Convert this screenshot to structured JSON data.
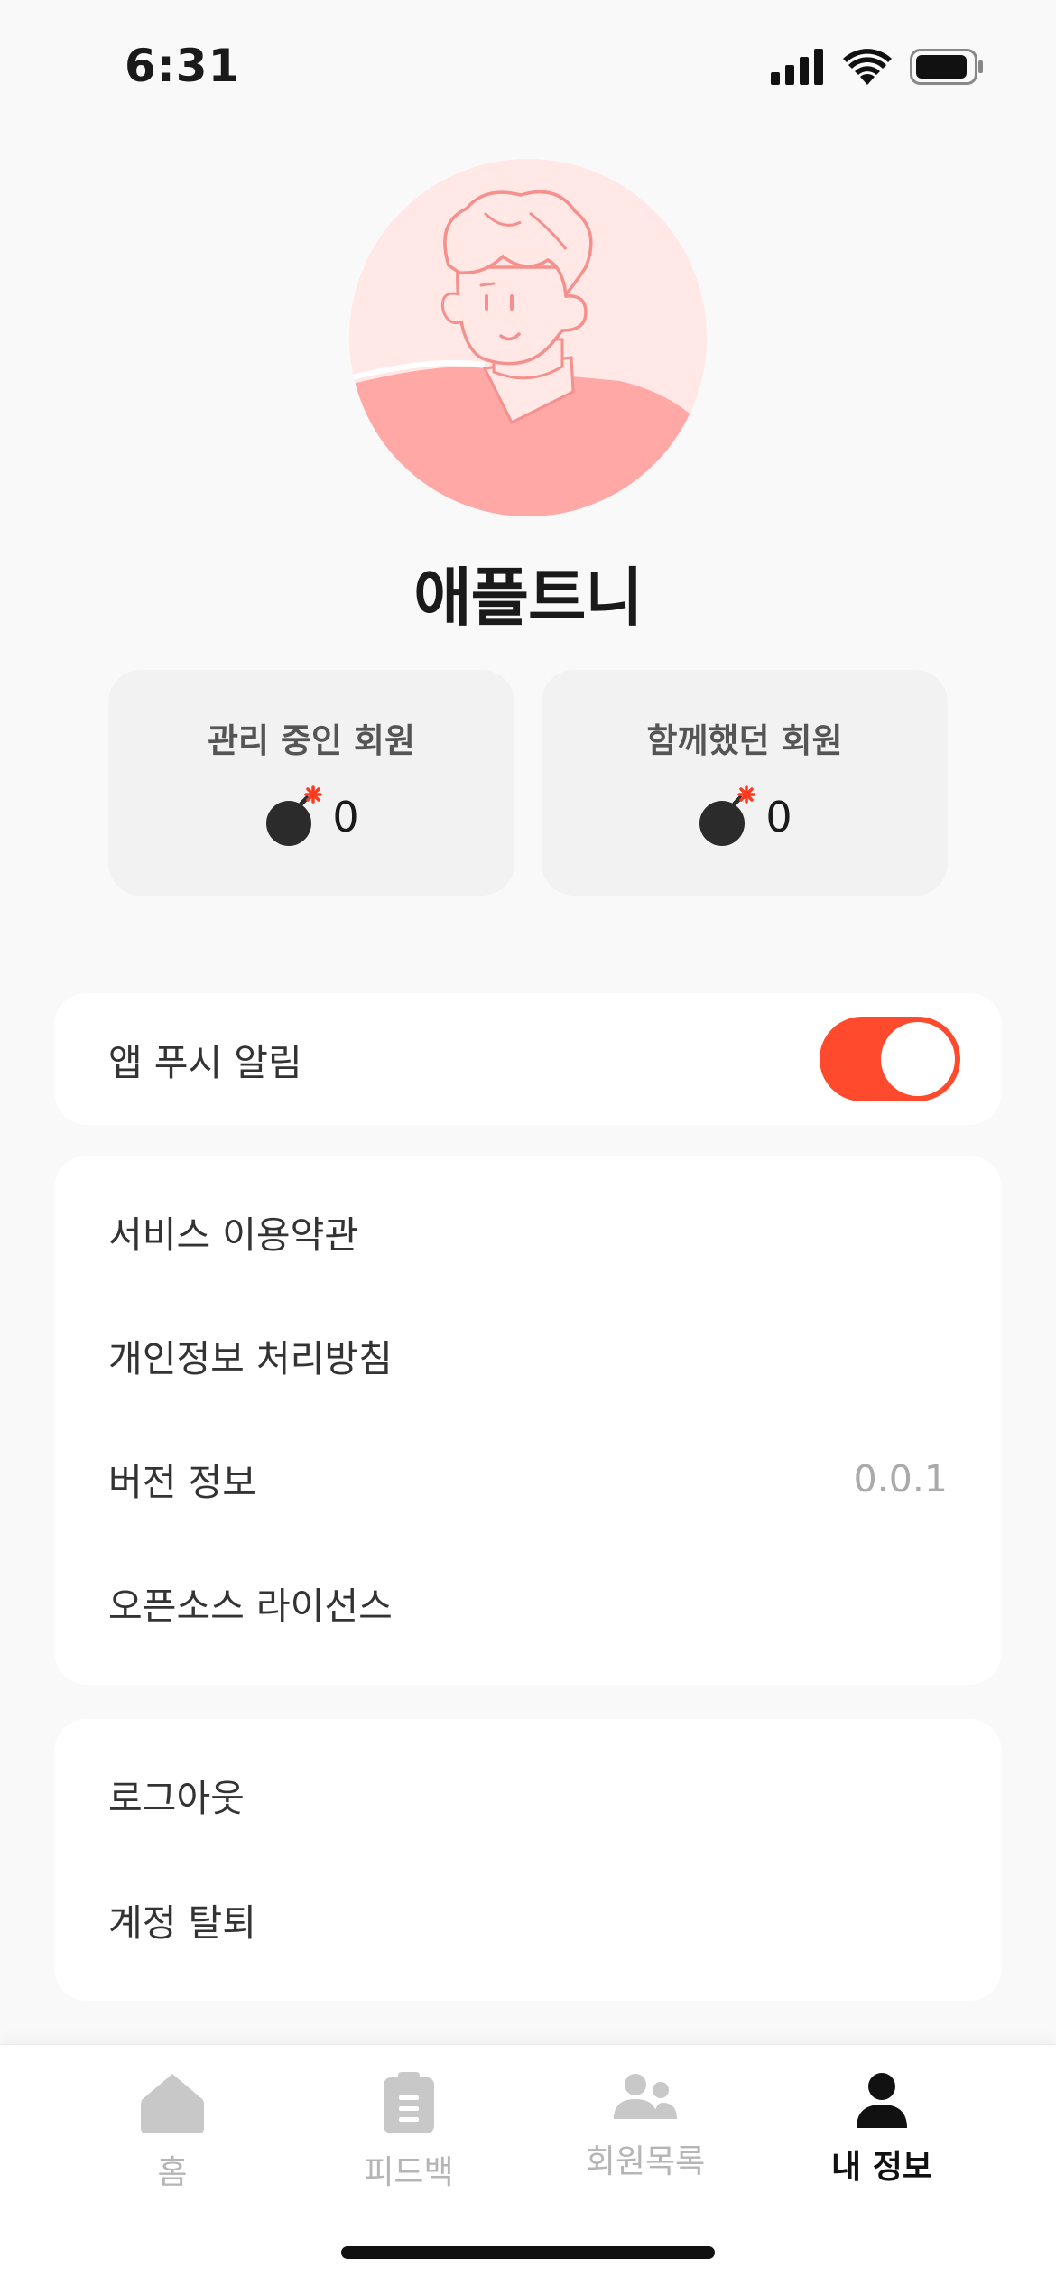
{
  "status_bar": {
    "time": "6:31"
  },
  "profile": {
    "name": "애플트니"
  },
  "stats": [
    {
      "label": "관리 중인 회원",
      "value": "0",
      "icon": "bomb-icon"
    },
    {
      "label": "함께했던 회원",
      "value": "0",
      "icon": "bomb-icon"
    }
  ],
  "settings": {
    "push": {
      "label": "앱 푸시 알림",
      "enabled": true
    },
    "info_items": [
      {
        "label": "서비스 이용약관",
        "value": ""
      },
      {
        "label": "개인정보 처리방침",
        "value": ""
      },
      {
        "label": "버전 정보",
        "value": "0.0.1"
      },
      {
        "label": "오픈소스 라이선스",
        "value": ""
      }
    ],
    "account_items": [
      {
        "label": "로그아웃"
      },
      {
        "label": "계정 탈퇴"
      }
    ]
  },
  "tabs": [
    {
      "label": "홈",
      "icon": "home-icon",
      "active": false
    },
    {
      "label": "피드백",
      "icon": "clipboard-icon",
      "active": false
    },
    {
      "label": "회원목록",
      "icon": "users-icon",
      "active": false
    },
    {
      "label": "내 정보",
      "icon": "person-icon",
      "active": true
    }
  ],
  "colors": {
    "accent": "#ff4a2d",
    "avatar_bg": "#ffe8e6",
    "avatar_shirt": "#ffa8a6",
    "tab_inactive": "#b5b5b5"
  }
}
